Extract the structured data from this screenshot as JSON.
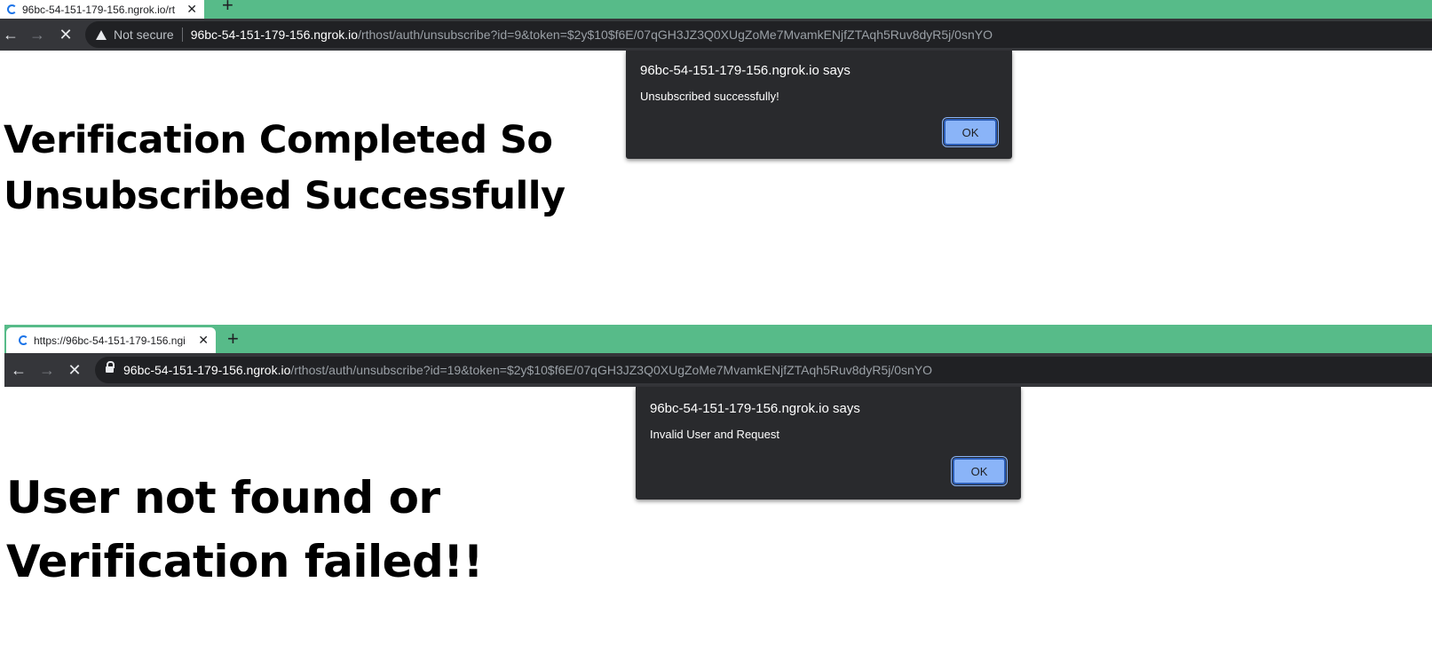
{
  "top": {
    "tab_title": "96bc-54-151-179-156.ngrok.io/rt",
    "newtab_label": "+",
    "security_label": "Not secure",
    "url_host": "96bc-54-151-179-156.ngrok.io",
    "url_path": "/rthost/auth/unsubscribe?id=9&token=$2y$10$f6E/07qGH3JZ3Q0XUgZoMe7MvamkENjfZTAqh5Ruv8dyR5j/0snYO",
    "dialog": {
      "title": "96bc-54-151-179-156.ngrok.io says",
      "message": "Unsubscribed successfully!",
      "ok_label": "OK"
    },
    "heading_line1": "Verification Completed So",
    "heading_line2": "Unsubscribed Successfully"
  },
  "bottom": {
    "tab_title": "https://96bc-54-151-179-156.ngi",
    "newtab_label": "+",
    "url_host": "96bc-54-151-179-156.ngrok.io",
    "url_path": "/rthost/auth/unsubscribe?id=19&token=$2y$10$f6E/07qGH3JZ3Q0XUgZoMe7MvamkENjfZTAqh5Ruv8dyR5j/0snYO",
    "dialog": {
      "title": "96bc-54-151-179-156.ngrok.io says",
      "message": "Invalid User and Request",
      "ok_label": "OK"
    },
    "heading_line1": "User not found or",
    "heading_line2": "Verification failed!!"
  },
  "icons": {
    "back": "←",
    "forward": "→",
    "stop": "✕",
    "tab_close": "✕"
  },
  "colors": {
    "tabstrip": "#57bb89",
    "toolbar": "#35363a",
    "dialog": "#292a2d",
    "ok_button": "#8ab4f8"
  }
}
